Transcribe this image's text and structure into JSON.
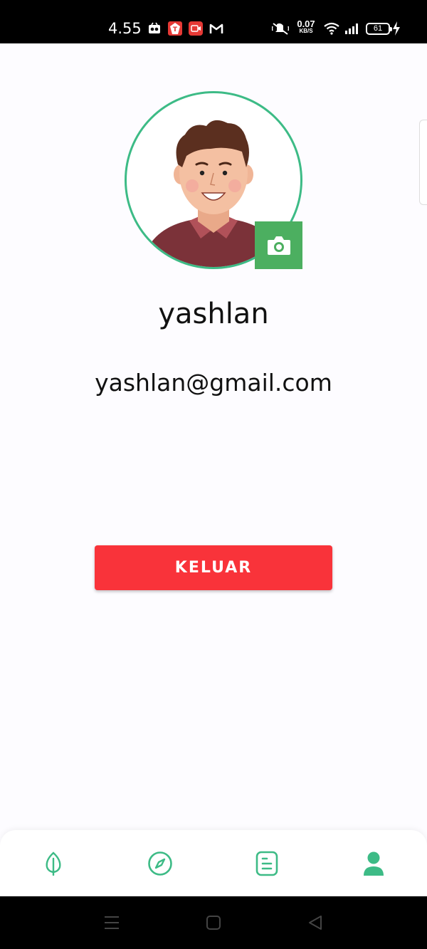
{
  "status_bar": {
    "time": "4.55",
    "net_speed_value": "0.07",
    "net_speed_unit": "KB/S",
    "battery": "61"
  },
  "profile": {
    "username": "yashlan",
    "email": "yashlan@gmail.com"
  },
  "actions": {
    "logout_label": "KELUAR"
  },
  "bottom_nav": {
    "items": [
      {
        "icon": "leaf-icon",
        "active": false
      },
      {
        "icon": "compass-icon",
        "active": false
      },
      {
        "icon": "document-icon",
        "active": false
      },
      {
        "icon": "user-icon",
        "active": true
      }
    ]
  },
  "colors": {
    "accent": "#3dbb86",
    "camera_button": "#4caf60",
    "logout_button": "#f9333a"
  }
}
